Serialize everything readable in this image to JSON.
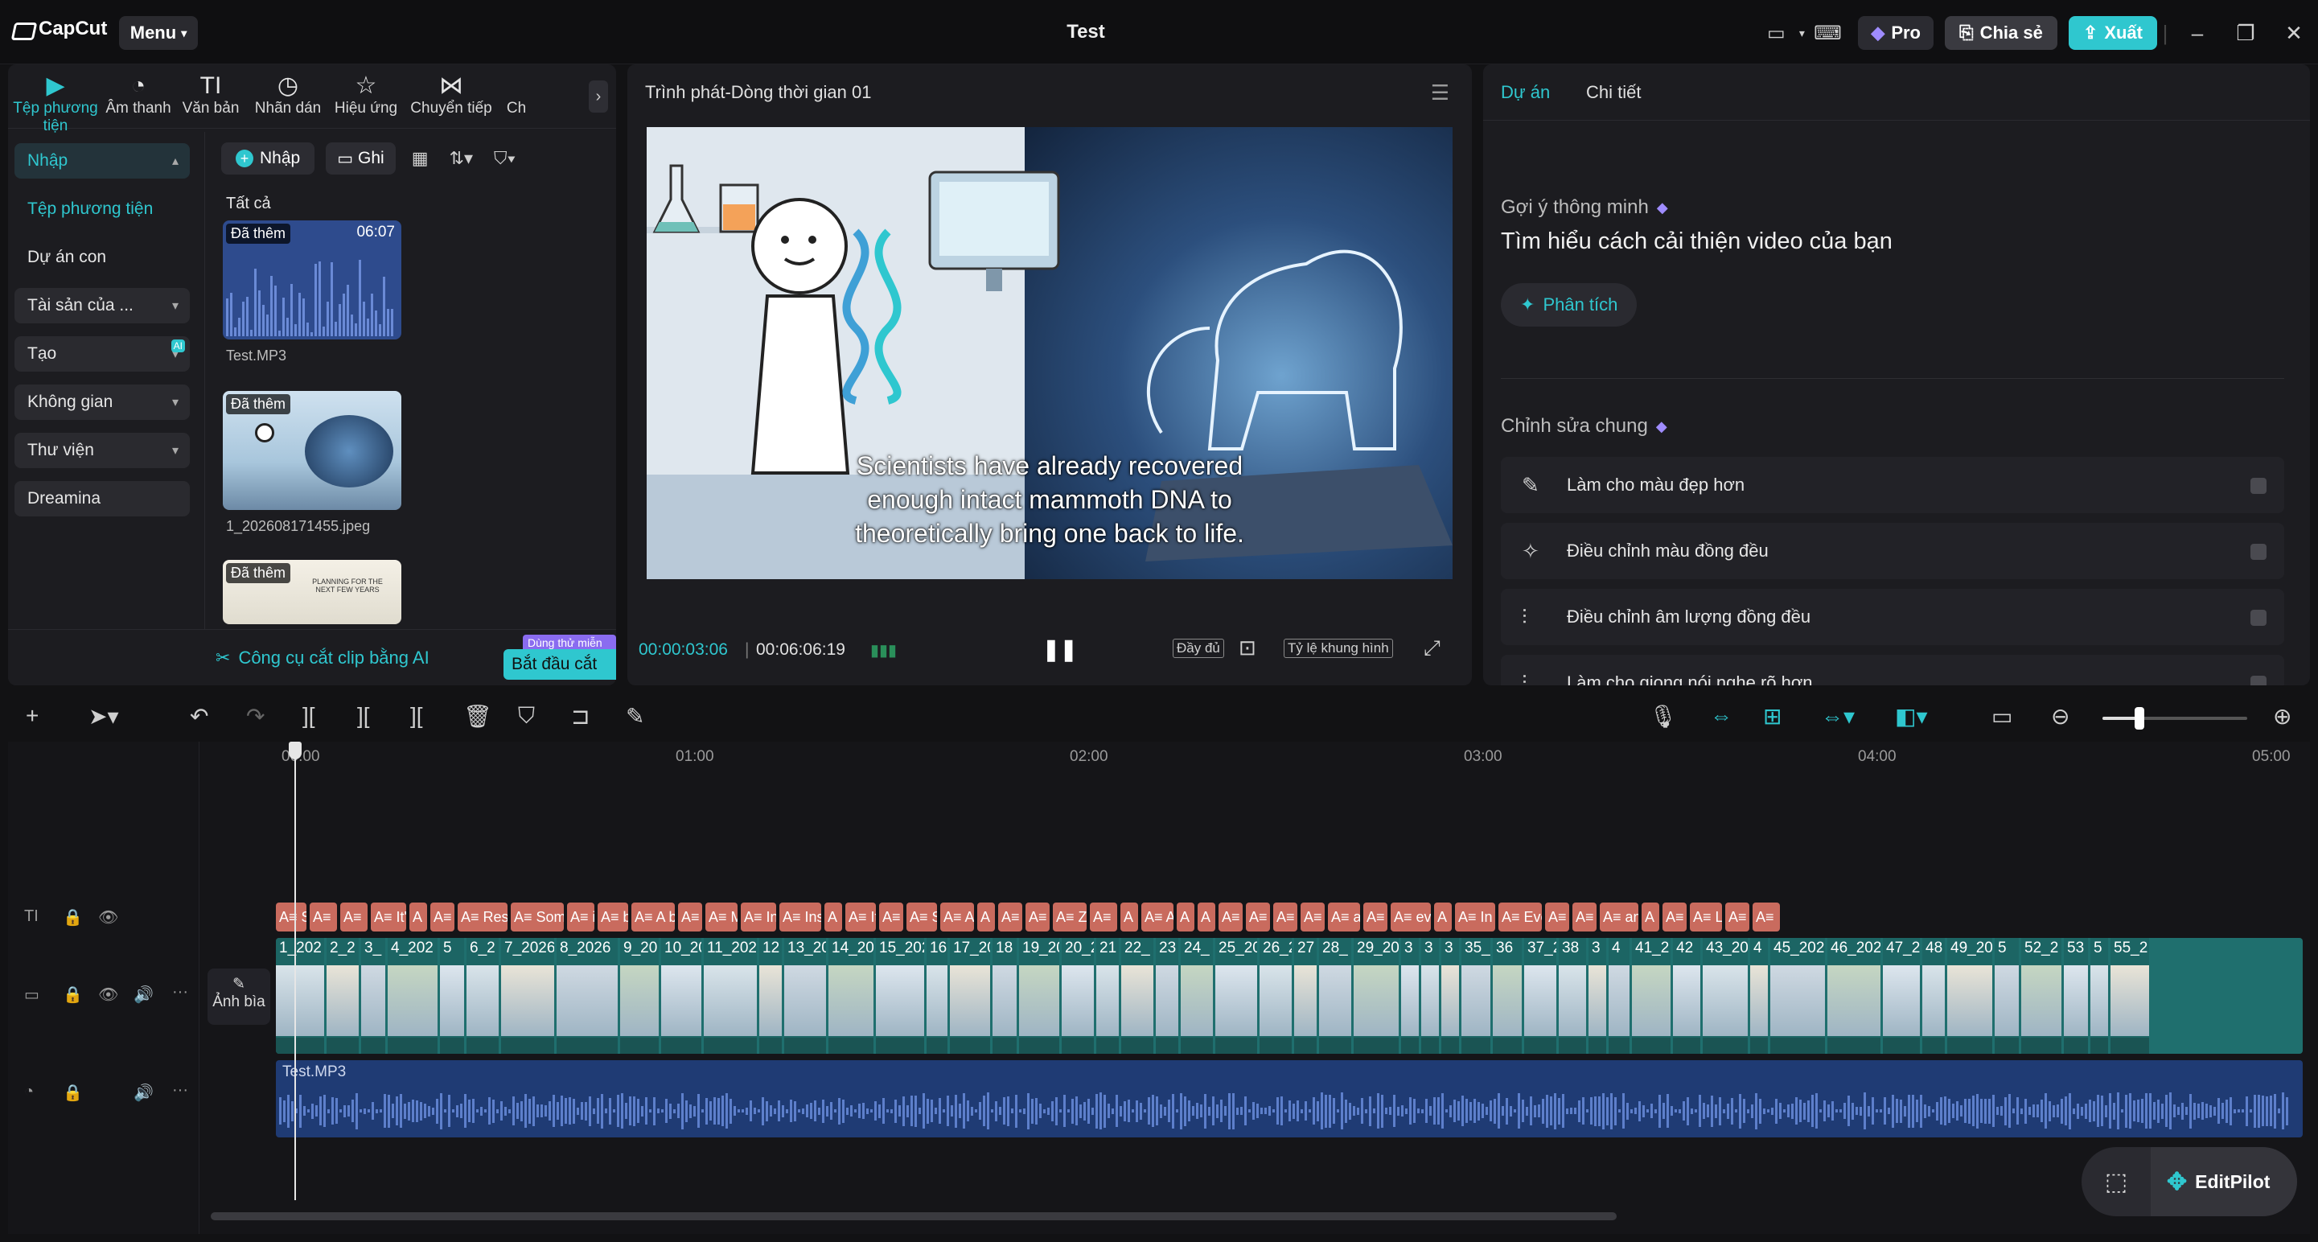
{
  "app": {
    "logo": "CapCut",
    "menu": "Menu",
    "title": "Test"
  },
  "header": {
    "pro": "Pro",
    "share": "Chia sẻ",
    "export": "Xuất"
  },
  "tools": [
    "Tệp phương tiện",
    "Âm thanh",
    "Văn bản",
    "Nhãn dán",
    "Hiệu ứng",
    "Chuyển tiếp",
    "Ch"
  ],
  "sidenav": {
    "import": "Nhập",
    "media": "Tệp phương tiện",
    "subproject": "Dự án con",
    "assets": "Tài sản của ...",
    "create": "Tạo",
    "create_badge": "AI",
    "space": "Không gian",
    "library": "Thư viện",
    "dreamina": "Dreamina"
  },
  "media": {
    "import_btn": "Nhập",
    "record_btn": "Ghi",
    "all": "Tất cả",
    "added": "Đã thêm",
    "item1_duration": "06:07",
    "item1_name": "Test.MP3",
    "item2_name": "1_202608171455.jpeg",
    "item3_text": "PLANNING FOR THE NEXT FEW YEARS"
  },
  "ai_tool": {
    "label": "Công cụ cắt clip bằng AI",
    "badge": "Dùng thử miễn phí",
    "start": "Bắt đầu cắt"
  },
  "player": {
    "title": "Trình phát-Dòng thời gian 01",
    "caption_line1": "Scientists have already recovered",
    "caption_line2": "enough intact mammoth DNA to",
    "caption_line3": "theoretically bring one back to life.",
    "time_current": "00:00:03:06",
    "time_total": "00:06:06:19",
    "full": "Đầy đủ",
    "ratio": "Tỷ lệ khung hình"
  },
  "right": {
    "tab_project": "Dự án",
    "tab_detail": "Chi tiết",
    "smart_title": "Gợi ý thông minh",
    "smart_hint": "Tìm hiểu cách cải thiện video của bạn",
    "analyze": "Phân tích",
    "general_title": "Chỉnh sửa chung",
    "options": [
      "Làm cho màu đẹp hơn",
      "Điều chỉnh màu đồng đều",
      "Điều chỉnh âm lượng đồng đều",
      "Làm cho giọng nói nghe rõ hơn"
    ]
  },
  "timeline": {
    "ruler": [
      "00:00",
      "01:00",
      "02:00",
      "03:00",
      "04:00",
      "05:00"
    ],
    "cover": "Ảnh bìa",
    "audio_name": "Test.MP3",
    "text_clips": [
      "A≡ Sc",
      "A≡",
      "A≡",
      "A≡ It'",
      "A",
      "A≡",
      "A≡ Res",
      "A≡ Som",
      "A≡ i",
      "A≡ bi",
      "A≡ A bic",
      "A≡",
      "A≡ M",
      "A≡ Ina",
      "A≡ Inse",
      "A",
      "A≡ It",
      "A≡",
      "A≡ S",
      "A≡ A",
      "A",
      "A≡",
      "A≡",
      "A≡ Zc",
      "A≡",
      "A",
      "A≡ A",
      "A",
      "A",
      "A≡",
      "A≡",
      "A≡",
      "A≡",
      "A≡ a",
      "A≡",
      "A≡ ev",
      "A",
      "A≡ In m",
      "A≡ Eve",
      "A≡",
      "A≡",
      "A≡ an",
      "A",
      "A≡",
      "A≡ L",
      "A≡",
      "A≡"
    ],
    "video_clips": [
      "1_202",
      "2_2",
      "3_",
      "4_202",
      "5",
      "6_2",
      "7_2026",
      "8_2026",
      "9_20",
      "10_20",
      "11_2026",
      "12",
      "13_20",
      "14_20",
      "15_202",
      "16",
      "17_20",
      "18",
      "19_20",
      "20_2",
      "21",
      "22_",
      "23",
      "24_",
      "25_20",
      "26_2",
      "27",
      "28_",
      "29_20",
      "3",
      "3",
      "3",
      "35_",
      "36",
      "37_2",
      "38",
      "3",
      "4",
      "41_2",
      "42",
      "43_20",
      "4",
      "45_202",
      "46_202",
      "47_2",
      "48",
      "49_20",
      "5",
      "52_2",
      "53",
      "5",
      "55_2"
    ],
    "editpilot": "EditPilot"
  }
}
